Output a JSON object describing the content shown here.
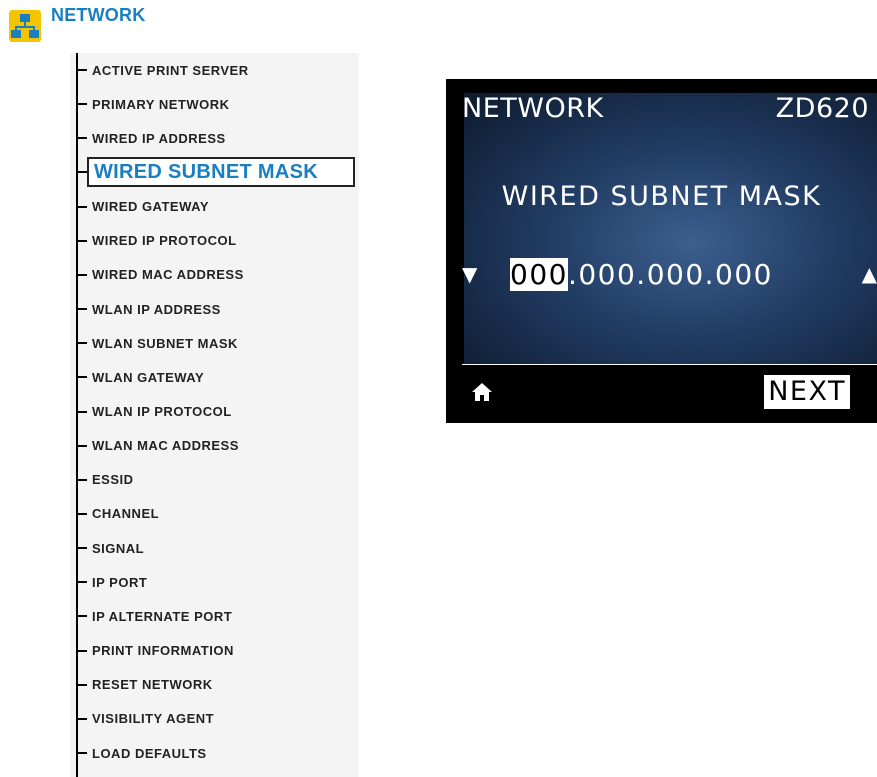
{
  "header": {
    "icon": "network-icon",
    "title": "NETWORK",
    "accent_color": "#1a7fc1",
    "icon_color": "#f5c400"
  },
  "menu": {
    "items": [
      {
        "label": "ACTIVE PRINT SERVER"
      },
      {
        "label": "PRIMARY NETWORK"
      },
      {
        "label": "WIRED IP ADDRESS"
      },
      {
        "label": "WIRED SUBNET MASK",
        "selected": true
      },
      {
        "label": "WIRED GATEWAY"
      },
      {
        "label": "WIRED IP PROTOCOL"
      },
      {
        "label": "WIRED MAC ADDRESS"
      },
      {
        "label": "WLAN IP ADDRESS"
      },
      {
        "label": "WLAN SUBNET MASK"
      },
      {
        "label": "WLAN GATEWAY"
      },
      {
        "label": "WLAN IP PROTOCOL"
      },
      {
        "label": "WLAN MAC ADDRESS"
      },
      {
        "label": "ESSID"
      },
      {
        "label": "CHANNEL"
      },
      {
        "label": "SIGNAL"
      },
      {
        "label": "IP PORT"
      },
      {
        "label": "IP ALTERNATE PORT"
      },
      {
        "label": "PRINT INFORMATION"
      },
      {
        "label": "RESET NETWORK"
      },
      {
        "label": "VISIBILITY AGENT"
      },
      {
        "label": "LOAD DEFAULTS"
      }
    ]
  },
  "display": {
    "menu_name": "NETWORK",
    "model": "ZD620",
    "setting": "WIRED SUBNET MASK",
    "value_active_octet": "000",
    "value_rest": ".000.000.000",
    "down_arrow": "▼",
    "up_arrow": "▲",
    "home_icon": "home-icon",
    "next_label": "NEXT"
  }
}
